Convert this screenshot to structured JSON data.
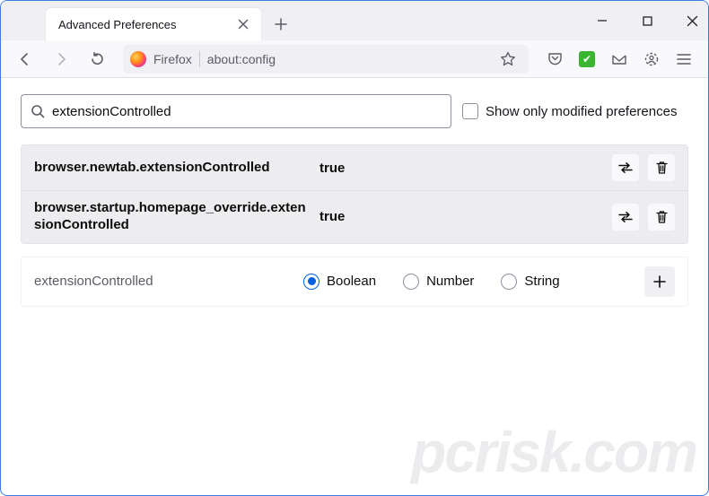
{
  "window": {
    "tab_title": "Advanced Preferences"
  },
  "toolbar": {
    "identity_label": "Firefox",
    "url": "about:config"
  },
  "search": {
    "value": "extensionControlled",
    "only_modified_label": "Show only modified preferences"
  },
  "prefs": [
    {
      "name": "browser.newtab.extensionControlled",
      "value": "true",
      "modified": true
    },
    {
      "name": "browser.startup.homepage_override.extensionControlled",
      "value": "true",
      "modified": true
    }
  ],
  "new_pref": {
    "name": "extensionControlled",
    "types": {
      "boolean": "Boolean",
      "number": "Number",
      "string": "String"
    },
    "selected": "boolean"
  },
  "watermark": "pcrisk.com"
}
